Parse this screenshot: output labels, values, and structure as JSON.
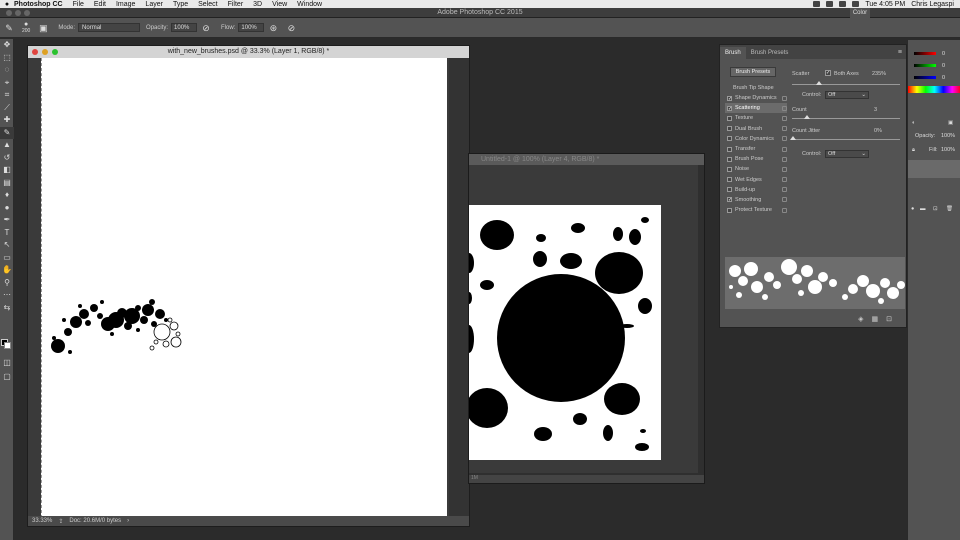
{
  "menubar": {
    "app_name": "Photoshop CC",
    "items": [
      "File",
      "Edit",
      "Image",
      "Layer",
      "Type",
      "Select",
      "Filter",
      "3D",
      "View",
      "Window"
    ],
    "clock": "Tue 4:05 PM",
    "user": "Chris Legaspi"
  },
  "window": {
    "title": "Adobe Photoshop CC 2015",
    "color_tab": "Color"
  },
  "options": {
    "brush_size": "200",
    "mode_label": "Mode:",
    "mode_value": "Normal",
    "opacity_label": "Opacity:",
    "opacity_value": "100%",
    "flow_label": "Flow:",
    "flow_value": "100%"
  },
  "doc1": {
    "title": "with_new_brushes.psd @ 33.3% (Layer 1, RGB/8) *",
    "zoom": "33.33%",
    "doc_info": "Doc: 20.6M/0 bytes"
  },
  "doc2": {
    "title": "Untitled-1 @ 100% (Layer 4, RGB/8) *",
    "zoom": "1M"
  },
  "brush_panel": {
    "tabs": [
      "Brush",
      "Brush Presets"
    ],
    "presets_button": "Brush Presets",
    "tip_shape": "Brush Tip Shape",
    "options": [
      {
        "label": "Shape Dynamics",
        "checked": true
      },
      {
        "label": "Scattering",
        "checked": true,
        "selected": true
      },
      {
        "label": "Texture",
        "checked": false
      },
      {
        "label": "Dual Brush",
        "checked": false
      },
      {
        "label": "Color Dynamics",
        "checked": false
      },
      {
        "label": "Transfer",
        "checked": false
      },
      {
        "label": "Brush Pose",
        "checked": false
      },
      {
        "label": "Noise",
        "checked": false
      },
      {
        "label": "Wet Edges",
        "checked": false
      },
      {
        "label": "Build-up",
        "checked": false
      },
      {
        "label": "Smoothing",
        "checked": true
      },
      {
        "label": "Protect Texture",
        "checked": false
      }
    ],
    "scatter_label": "Scatter",
    "both_axes_label": "Both Axes",
    "scatter_value": "235%",
    "control_label": "Control:",
    "control_value": "Off",
    "count_label": "Count",
    "count_value": "3",
    "count_jitter_label": "Count Jitter",
    "count_jitter_value": "0%",
    "control2_label": "Control:",
    "control2_value": "Off"
  },
  "right_panel": {
    "color_values": [
      "0",
      "0",
      "0"
    ],
    "opacity_label": "Opacity:",
    "opacity_value": "100%",
    "fill_label": "Fill:",
    "fill_value": "100%"
  }
}
